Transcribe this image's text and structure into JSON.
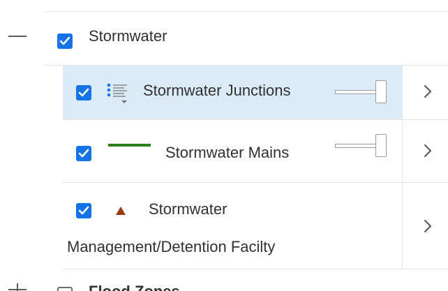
{
  "group": {
    "label": "Stormwater",
    "expanded": true,
    "checked": true
  },
  "layers": [
    {
      "label": "Stormwater Junctions",
      "checked": true,
      "icon": "point-legend-icon",
      "selected": true
    },
    {
      "label": "Stormwater Mains",
      "checked": true,
      "icon": "green-line-symbol-icon",
      "line_color": "#2e7d1f"
    },
    {
      "label_line1": "Stormwater",
      "label_line2": "Management/Detention Facilty",
      "checked": true,
      "icon": "brown-triangle-icon",
      "symbol_color": "#9a3a12"
    }
  ],
  "next_group": {
    "label": "Flood Zones",
    "checked": false
  },
  "colors": {
    "accent": "#1473e6",
    "selected_row": "#dcebf8",
    "divider": "#e6e6e6"
  }
}
